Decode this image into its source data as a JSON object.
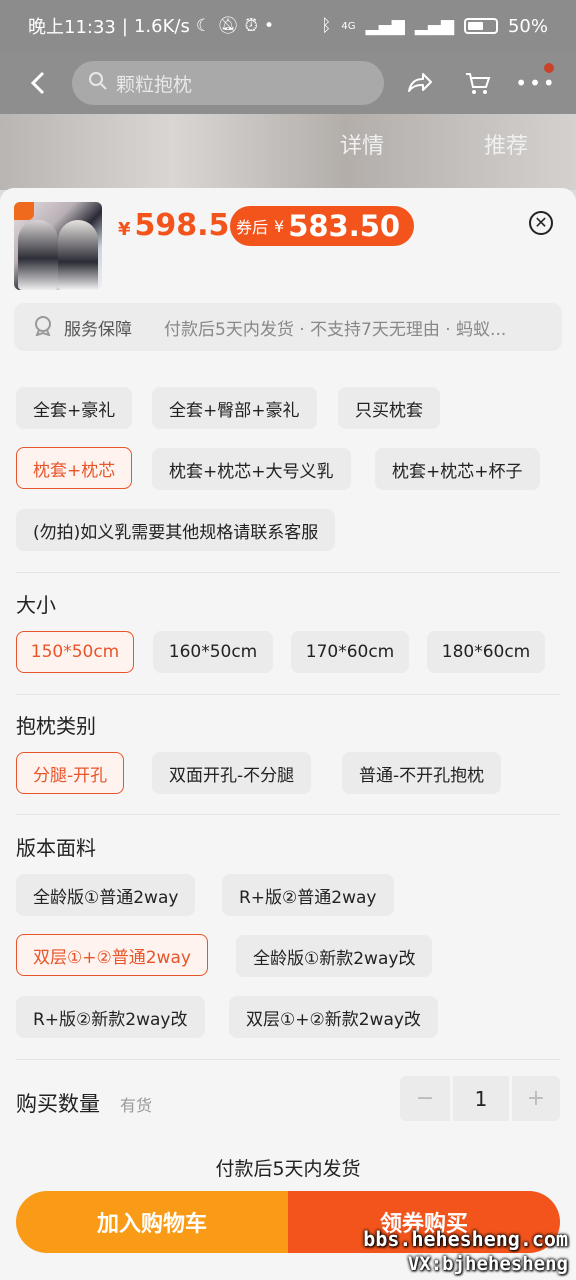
{
  "status_bar": {
    "time": "晚上11:33",
    "speed": "1.6K/s",
    "battery": "50%",
    "network": "4G"
  },
  "nav": {
    "search_text": "颗粒抱枕",
    "back_icon": "back-arrow-icon",
    "share_icon": "share-icon",
    "cart_icon": "cart-icon",
    "more_icon": "more-icon"
  },
  "banner": {
    "tab_detail": "详情",
    "tab_recommend": "推荐"
  },
  "product": {
    "price_symbol": "¥",
    "price": "598.5",
    "coupon_label": "券后",
    "coupon_symbol": "¥",
    "coupon_price": "583.50"
  },
  "service": {
    "label": "服务保障",
    "text": "付款后5天内发货 · 不支持7天无理由 · 蚂蚁..."
  },
  "options": {
    "set": [
      "全套+豪礼",
      "全套+臀部+豪礼",
      "只买枕套",
      "枕套+枕芯",
      "枕套+枕芯+大号义乳",
      "枕套+枕芯+杯子",
      "(勿拍)如义乳需要其他规格请联系客服"
    ],
    "set_selected": "枕套+枕芯",
    "size_title": "大小",
    "size": [
      "150*50cm",
      "160*50cm",
      "170*60cm",
      "180*60cm"
    ],
    "size_selected": "150*50cm",
    "type_title": "抱枕类别",
    "type": [
      "分腿-开孔",
      "双面开孔-不分腿",
      "普通-不开孔抱枕"
    ],
    "type_selected": "分腿-开孔",
    "fabric_title": "版本面料",
    "fabric": [
      "全龄版①普通2way",
      "R+版②普通2way",
      "双层①+②普通2way",
      "全龄版①新款2way改",
      "R+版②新款2way改",
      "双层①+②新款2way改"
    ],
    "fabric_selected": "双层①+②普通2way"
  },
  "quantity": {
    "label": "购买数量",
    "stock": "有货",
    "value": "1",
    "minus": "−",
    "plus": "+"
  },
  "shipping_note": "付款后5天内发货",
  "actions": {
    "add_cart": "加入购物车",
    "buy": "领券购买"
  },
  "watermark": {
    "line1": "bbs.hehesheng.com",
    "line2": "VX:bjhehesheng"
  },
  "colors": {
    "accent": "#f2541c",
    "cart": "#fa9b17",
    "chip_bg": "#ebebeb",
    "selected_bg": "#fff3ef"
  }
}
